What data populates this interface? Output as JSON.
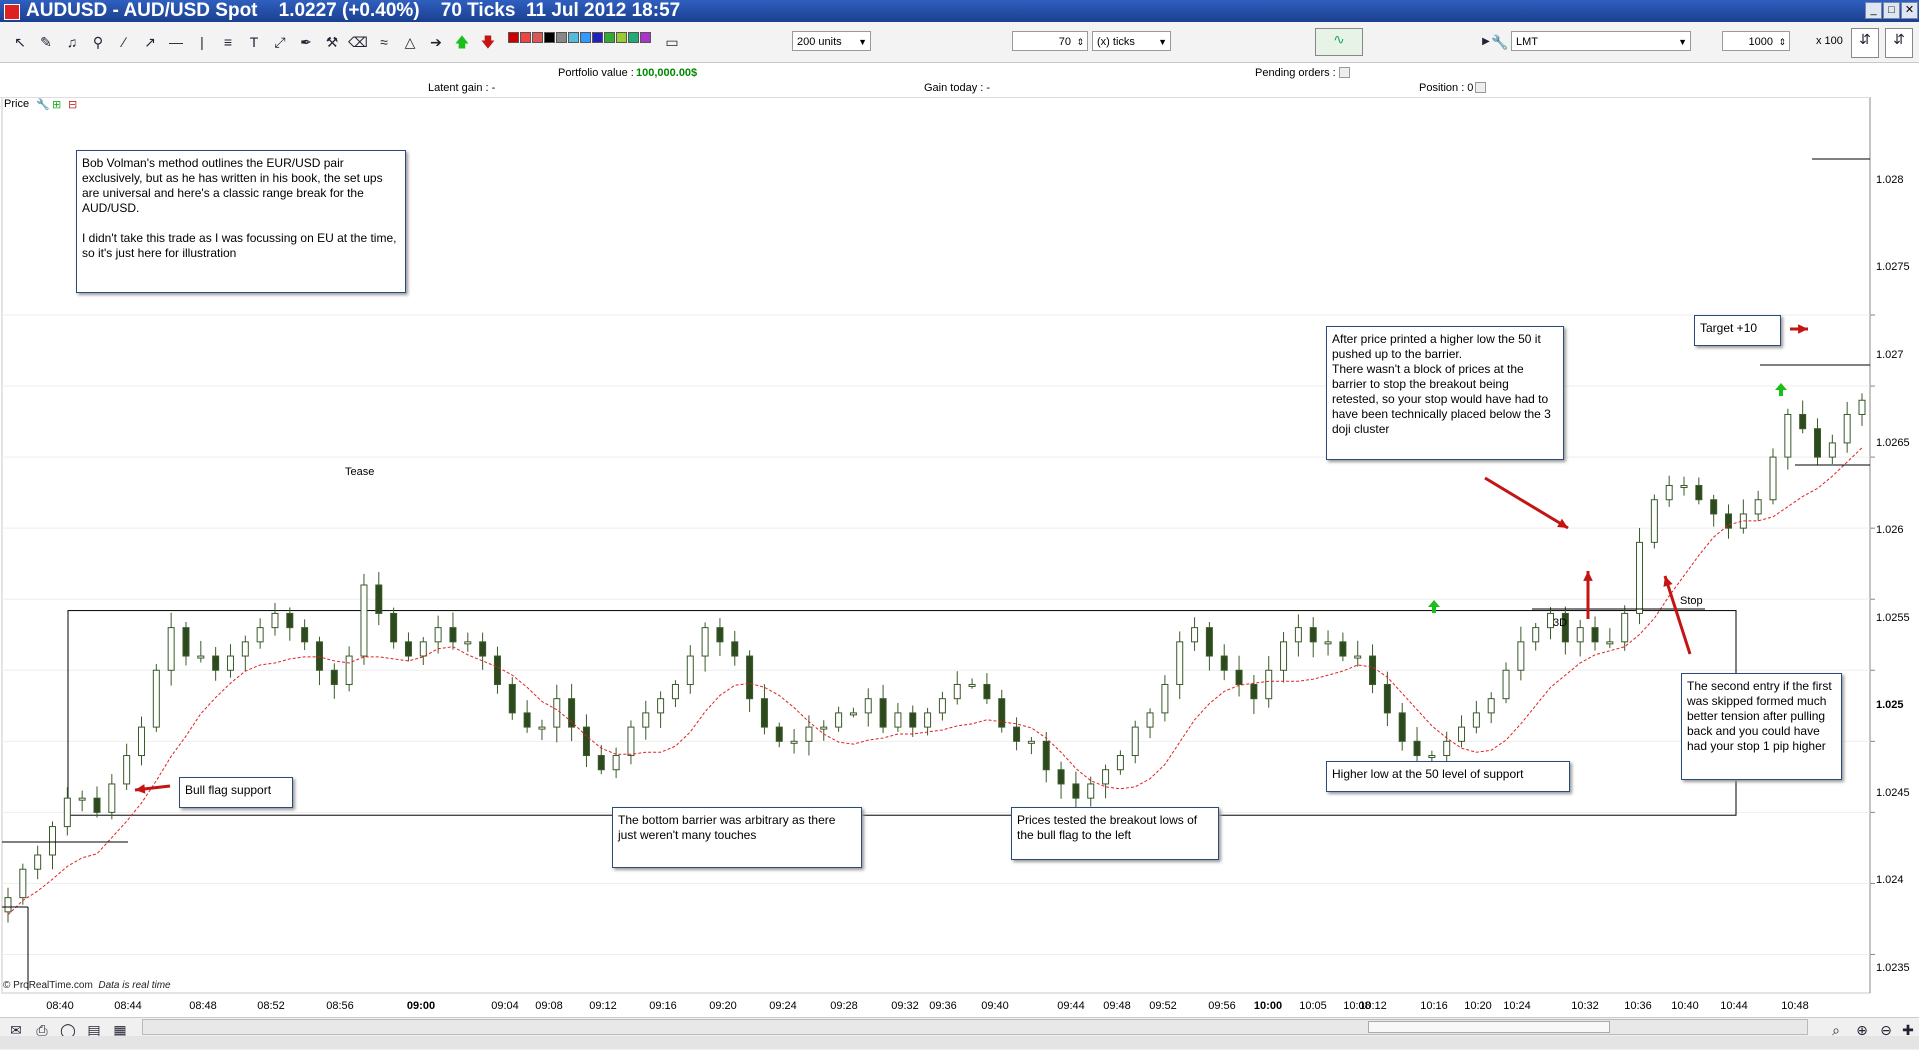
{
  "window": {
    "title": "AUDUSD - AUD/USD Spot    1.0227 (+0.40%)    70 Ticks  11 Jul 2012 18:57",
    "minimize": "_",
    "maximize": "□",
    "close": "✕"
  },
  "toolbar": {
    "units_select": "200 units",
    "ticks_value": "70",
    "ticks_type": "(x) ticks",
    "order_type": "LMT",
    "quantity": "1000",
    "multiplier": "x 100"
  },
  "infobar": {
    "portfolio_label": "Portfolio value :",
    "portfolio_value": "100,000.00$",
    "pending_label": "Pending orders : 0",
    "latent_label": "Latent gain : -",
    "gain_today_label": "Gain today : -",
    "position_label": "Position : 0"
  },
  "panel": {
    "price_label": "Price"
  },
  "annotations": {
    "intro": "Bob Volman's method outlines the EUR/USD pair exclusively, but as he has written in his book, the set ups are universal and here's a classic range break for the AUD/USD.\n\nI didn't take this trade as I was focussing on EU at the time, so it's just here for illustration",
    "bull_flag": "Bull flag support",
    "bottom_barrier": "The bottom barrier was arbitrary as there just weren't many touches",
    "tested_lows": "Prices tested the breakout lows of the bull flag to the left",
    "higher_low": "Higher low at the 50 level of support",
    "after_price": "After price printed a higher low the 50 it pushed up to the barrier.\nThere wasn't a block of prices at the barrier to stop the breakout being retested, so your stop would have had to have been technically placed below the 3 doji cluster",
    "second_entry": "The second entry if the first was skipped formed much better tension after pulling back and you could have had your stop 1 pip higher",
    "target": "Target +10",
    "tease": "Tease",
    "three_d": "3D",
    "stop": "Stop"
  },
  "credit": {
    "brand": "© ProRealTime.com",
    "note": "Data is real time"
  },
  "chart_data": {
    "type": "candlestick",
    "symbol": "AUDUSD",
    "ylim": [
      1.02325,
      1.02895
    ],
    "y_ticks": [
      "1.028",
      "1.0275",
      "1.027",
      "1.0265",
      "1.026",
      "1.0255",
      "1.025",
      "1.0245",
      "1.024",
      "1.0235"
    ],
    "x_ticks": [
      "08:40",
      "08:44",
      "08:48",
      "08:52",
      "08:56",
      "09:00",
      "09:04",
      "09:08",
      "09:12",
      "09:16",
      "09:20",
      "09:24",
      "09:28",
      "09:32",
      "09:36",
      "09:40",
      "09:44",
      "09:48",
      "09:52",
      "09:56",
      "10:00",
      "10:05",
      "10:08",
      "10:12",
      "10:16",
      "10:20",
      "10:24",
      "10:32",
      "10:36",
      "10:40",
      "10:44",
      "10:48"
    ],
    "range_box": {
      "top": 1.02592,
      "bottom": 1.02448
    },
    "closes": [
      1.0239,
      1.0241,
      1.0242,
      1.0244,
      1.0246,
      1.0246,
      1.0245,
      1.0247,
      1.0249,
      1.0251,
      1.0255,
      1.0258,
      1.0256,
      1.0256,
      1.0255,
      1.0256,
      1.0257,
      1.0258,
      1.0259,
      1.0258,
      1.0257,
      1.0255,
      1.0254,
      1.0256,
      1.0261,
      1.0259,
      1.0257,
      1.0256,
      1.0257,
      1.0258,
      1.0257,
      1.0257,
      1.0256,
      1.0254,
      1.0252,
      1.0251,
      1.0251,
      1.0253,
      1.0251,
      1.0249,
      1.0248,
      1.0249,
      1.0251,
      1.0252,
      1.0253,
      1.0254,
      1.0256,
      1.0258,
      1.0257,
      1.0256,
      1.0253,
      1.0251,
      1.025,
      1.025,
      1.0251,
      1.0251,
      1.0252,
      1.0252,
      1.0253,
      1.0251,
      1.0252,
      1.0251,
      1.0252,
      1.0253,
      1.0254,
      1.0254,
      1.0253,
      1.0251,
      1.025,
      1.025,
      1.0248,
      1.0247,
      1.0246,
      1.0247,
      1.0248,
      1.0249,
      1.0251,
      1.0252,
      1.0254,
      1.0257,
      1.0258,
      1.0256,
      1.0255,
      1.0254,
      1.0253,
      1.0255,
      1.0257,
      1.0258,
      1.0257,
      1.0257,
      1.0256,
      1.0256,
      1.0254,
      1.0252,
      1.025,
      1.0249,
      1.0249,
      1.025,
      1.0251,
      1.0252,
      1.0253,
      1.0255,
      1.0257,
      1.0258,
      1.0259,
      1.0257,
      1.0258,
      1.0257,
      1.0257,
      1.0259,
      1.0264,
      1.0267,
      1.0268,
      1.0268,
      1.0267,
      1.0266,
      1.0265,
      1.0266,
      1.0267,
      1.027,
      1.0273,
      1.0272,
      1.027,
      1.0271,
      1.0273,
      1.0274
    ]
  },
  "colors": {
    "candle_up": "#ffffff",
    "candle_outline": "#3a5a2a",
    "moving_average": "#e02020",
    "arrow_red": "#c41414",
    "arrow_green": "#1bbf1b",
    "portfolio_value": "#008800"
  }
}
